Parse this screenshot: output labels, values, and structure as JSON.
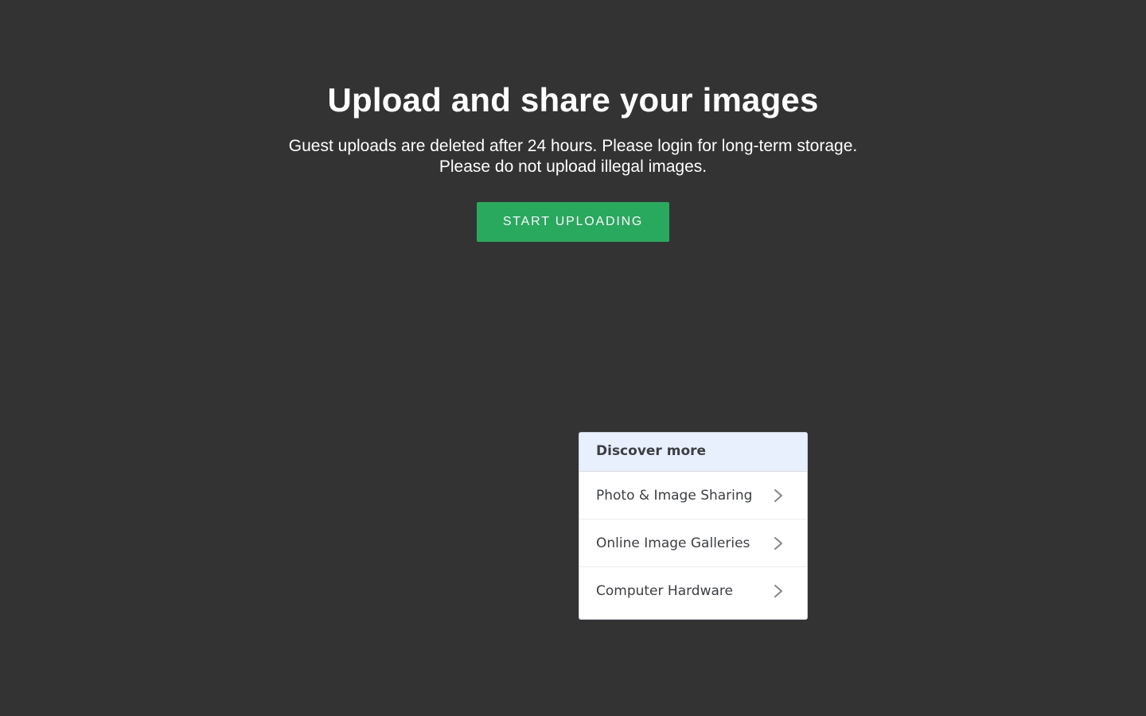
{
  "hero": {
    "title": "Upload and share your images",
    "subtitle_line1": "Guest uploads are deleted after 24 hours. Please login for long-term storage.",
    "subtitle_line2": "Please do not upload illegal images.",
    "button_label": "START UPLOADING"
  },
  "discover": {
    "heading": "Discover more",
    "items": [
      {
        "label": "Photo & Image Sharing",
        "icon": "chevron-right-icon"
      },
      {
        "label": "Online Image Galleries",
        "icon": "chevron-right-icon"
      },
      {
        "label": "Computer Hardware",
        "icon": "chevron-right-icon"
      }
    ]
  },
  "colors": {
    "background": "#333333",
    "button": "#28a95d",
    "discover_header": "#e8f0fe"
  }
}
